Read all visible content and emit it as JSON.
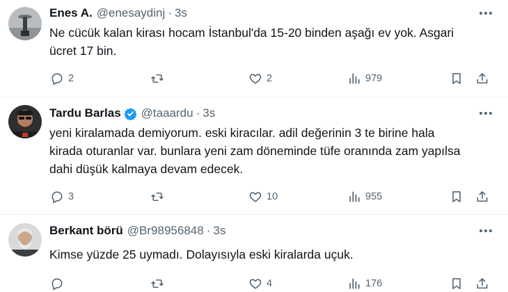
{
  "tweets": [
    {
      "name": "Enes A.",
      "handle": "@enesaydinj",
      "separator": "·",
      "time": "3s",
      "verified": false,
      "lines": [
        "Ne cücük kalan kirası hocam İstanbul'da 15-20 binden aşağı ev yok. Asgari",
        "ücret 17 bin."
      ],
      "replies": "2",
      "retweets": "",
      "likes": "2",
      "views": "979"
    },
    {
      "name": "Tardu Barlas",
      "handle": "@taaardu",
      "separator": "·",
      "time": "3s",
      "verified": true,
      "lines": [
        "yeni kiralamada demiyorum. eski kiracılar. adil değerinin 3 te birine hala",
        "kirada oturanlar var. bunlara yeni zam döneminde tüfe oranında zam yapılsa",
        "dahi düşük kalmaya devam edecek."
      ],
      "replies": "3",
      "retweets": "",
      "likes": "10",
      "views": "955"
    },
    {
      "name": "Berkant börü",
      "handle": "@Br98956848",
      "separator": "·",
      "time": "3s",
      "verified": false,
      "lines": [
        "Kimse yüzde 25 uymadı. Dolayısıyla eski kiralarda uçuk."
      ],
      "replies": "",
      "retweets": "",
      "likes": "4",
      "views": "176"
    }
  ],
  "icons": {
    "more": "more-dots-icon",
    "reply": "reply-bubble-icon",
    "retweet": "retweet-icon",
    "like": "heart-icon",
    "views": "views-chart-icon",
    "bookmark": "bookmark-icon",
    "share": "share-icon",
    "verified": "verified-badge-icon"
  },
  "colors": {
    "text": "#0f1419",
    "secondary": "#536471",
    "verified": "#1d9bf0",
    "divider": "#eff3f4"
  }
}
